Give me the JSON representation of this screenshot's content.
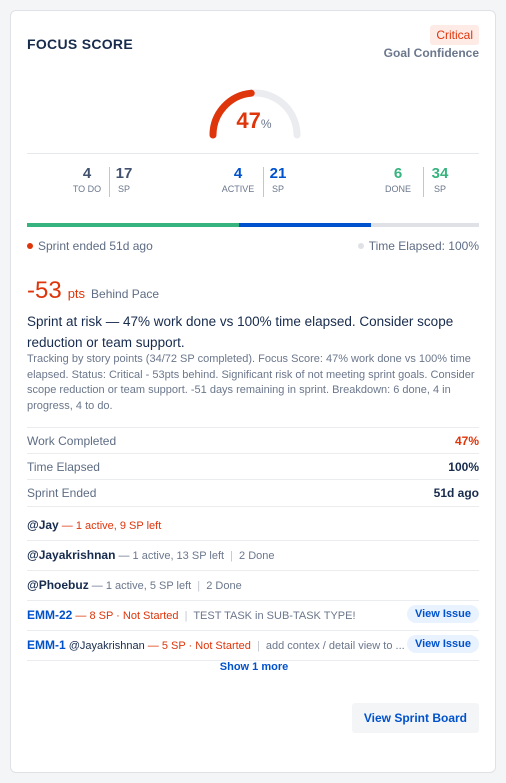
{
  "header": {
    "title": "FOCUS SCORE",
    "status_badge": "Critical",
    "subtitle": "Goal Confidence"
  },
  "gauge": {
    "value": 47,
    "value_label": "47",
    "unit": "%",
    "fill_fraction": 0.47,
    "color": "#de350b"
  },
  "stats": {
    "todo": {
      "count": "4",
      "count_label": "TO DO",
      "sp": "17",
      "sp_label": "SP",
      "color": "#42526e"
    },
    "active": {
      "count": "4",
      "count_label": "ACTIVE",
      "sp": "21",
      "sp_label": "SP",
      "color": "#0052cc"
    },
    "done": {
      "count": "6",
      "count_label": "DONE",
      "sp": "34",
      "sp_label": "SP",
      "color": "#36b37e"
    }
  },
  "progress": {
    "done_fraction": 0.47,
    "active_fraction": 0.29,
    "done_color": "#36b37e",
    "active_color": "#0052cc"
  },
  "sprint_status": {
    "left_text": "Sprint ended 51d ago",
    "right_text": "Time Elapsed: 100%"
  },
  "behind": {
    "value": "-53",
    "unit": "pts",
    "label": "Behind Pace"
  },
  "risk_summary": "Sprint at risk — 47% work done vs 100% time elapsed. Consider scope reduction or team support.",
  "detail_text": "Tracking by story points (34/72 SP completed). Focus Score: 47% work done vs 100% time elapsed. Status: Critical - 53pts behind. Significant risk of not meeting sprint goals. Consider scope reduction or team support. -51 days remaining in sprint. Breakdown: 6 done, 4 in progress, 4 to do.",
  "metrics": [
    {
      "label": "Work Completed",
      "value": "47%",
      "color": "#de350b"
    },
    {
      "label": "Time Elapsed",
      "value": "100%",
      "color": "#172b4d"
    },
    {
      "label": "Sprint Ended",
      "value": "51d ago",
      "color": "#172b4d"
    }
  ],
  "assignees": [
    {
      "name": "@Jay",
      "status": "— 1 active, 9 SP left",
      "done": ""
    },
    {
      "name": "@Jayakrishnan",
      "status": "— 1 active, 13 SP left",
      "done": "2 Done"
    },
    {
      "name": "@Phoebuz",
      "status": "— 1 active, 5 SP left",
      "done": "2 Done"
    }
  ],
  "issues": [
    {
      "key": "EMM-22",
      "assignee": "",
      "status": "— 8 SP · Not Started",
      "summary": "TEST TASK in SUB-TASK TYPE!",
      "action": "View Issue"
    },
    {
      "key": "EMM-1",
      "assignee": "@Jayakrishnan",
      "status": "— 5 SP · Not Started",
      "summary": "add contex / detail view to ...",
      "action": "View Issue"
    }
  ],
  "show_more": "Show 1 more",
  "footer_button": "View Sprint Board"
}
